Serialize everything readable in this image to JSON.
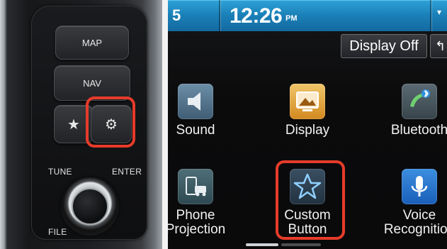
{
  "panel": {
    "map_label": "MAP",
    "nav_label": "NAV",
    "favorite_icon": "star-icon",
    "settings_icon": "gear-icon",
    "tune_label": "TUNE",
    "enter_label": "ENTER",
    "file_label": "FILE",
    "highlight_color": "#e63b2a"
  },
  "status_bar": {
    "left_text": "5",
    "time": "12:26",
    "ampm": "PM"
  },
  "toolbar": {
    "display_off_label": "Display Off"
  },
  "settings_tiles": [
    {
      "label_line1": "Sound",
      "label_line2": "",
      "icon": "speaker-icon"
    },
    {
      "label_line1": "Display",
      "label_line2": "",
      "icon": "display-icon"
    },
    {
      "label_line1": "Bluetooth",
      "label_line2": "",
      "icon": "bluetooth-phone-icon"
    },
    {
      "label_line1": "Phone",
      "label_line2": "Projection",
      "icon": "phone-projection-icon"
    },
    {
      "label_line1": "Custom",
      "label_line2": "Button",
      "icon": "star-outline-icon"
    },
    {
      "label_line1": "Voice",
      "label_line2": "Recognition",
      "icon": "microphone-icon"
    }
  ],
  "colors": {
    "status_bar": "#1a7fb7",
    "highlight": "#e63b2a"
  }
}
